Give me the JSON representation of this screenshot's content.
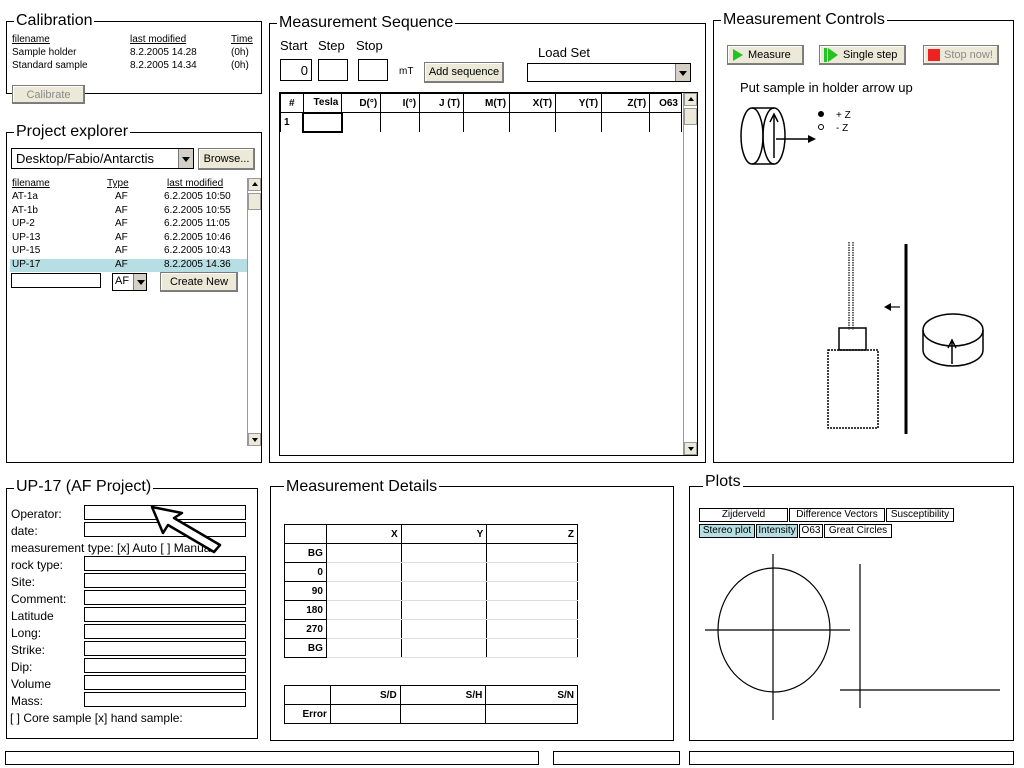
{
  "calibration": {
    "title": "Calibration",
    "headers": {
      "filename": "filename",
      "modified": "last modified",
      "time": "Time"
    },
    "rows": [
      {
        "filename": "Sample holder",
        "modified": "8.2.2005 14.28",
        "time": "(0h)"
      },
      {
        "filename": "Standard sample",
        "modified": "8.2.2005 14.34",
        "time": "(0h)"
      }
    ],
    "calibrate_label": "Calibrate"
  },
  "project_explorer": {
    "title": "Project explorer",
    "path": "Desktop/Fabio/Antarctis",
    "browse_label": "Browse...",
    "headers": {
      "filename": "filename",
      "type": "Type",
      "modified": "last modified"
    },
    "rows": [
      {
        "filename": "AT-1a",
        "type": "AF",
        "modified": "6.2.2005 10:50",
        "selected": false
      },
      {
        "filename": "AT-1b",
        "type": "AF",
        "modified": "6.2.2005 10:55",
        "selected": false
      },
      {
        "filename": "UP-2",
        "type": "AF",
        "modified": "6.2.2005 11:05",
        "selected": false
      },
      {
        "filename": "UP-13",
        "type": "AF",
        "modified": "6.2.2005 10:46",
        "selected": false
      },
      {
        "filename": "UP-15",
        "type": "AF",
        "modified": "6.2.2005 10:43",
        "selected": false
      },
      {
        "filename": "UP-17",
        "type": "AF",
        "modified": "8.2.2005 14.36",
        "selected": true
      }
    ],
    "new_name_value": "",
    "new_type_value": "AF",
    "create_label": "Create New",
    "selection_color": "#b7dfe3"
  },
  "sequence": {
    "title": "Measurement Sequence",
    "start_label": "Start",
    "step_label": "Step",
    "stop_label": "Stop",
    "start_value": "0",
    "step_value": "",
    "stop_value": "",
    "unit": "mT",
    "add_label": "Add sequence",
    "load_set_label": "Load Set",
    "load_set_value": "",
    "columns": [
      "#",
      "Tesla",
      "D(°)",
      "I(°)",
      "J (T)",
      "M(T)",
      "X(T)",
      "Y(T)",
      "Z(T)",
      "O63"
    ],
    "rows": [
      [
        "1",
        "",
        "",
        "",
        "",
        "",
        "",
        "",
        "",
        ""
      ]
    ]
  },
  "controls": {
    "title": "Measurement Controls",
    "measure_label": "Measure",
    "single_step_label": "Single step",
    "stop_label": "Stop now!",
    "instruction": "Put sample in holder arrow up",
    "plus_z": "+ Z",
    "minus_z": "- Z",
    "go_color": "#22c422",
    "stop_color": "#ee2222"
  },
  "project_form": {
    "title": "UP-17 (AF Project)",
    "operator_label": "Operator:",
    "operator_value": "",
    "date_label": "date:",
    "date_value": "",
    "mtype_label": "measurement type: [x] Auto [ ] Manual",
    "rocktype_label": "rock type:",
    "rocktype_value": "",
    "site_label": "Site:",
    "site_value": "",
    "comment_label": "Comment:",
    "comment_value": "",
    "latitude_label": "Latitude",
    "latitude_value": "",
    "long_label": "Long:",
    "long_value": "",
    "strike_label": "Strike:",
    "strike_value": "",
    "dip_label": "Dip:",
    "dip_value": "",
    "volume_label": "Volume",
    "volume_value": "",
    "mass_label": "Mass:",
    "mass_value": "",
    "sample_type_label": "[ ] Core sample [x]  hand sample:"
  },
  "details": {
    "title": "Measurement Details",
    "headers": [
      "",
      "X",
      "Y",
      "Z"
    ],
    "rows": [
      "BG",
      "0",
      "90",
      "180",
      "270",
      "BG"
    ],
    "error_headers": [
      "",
      "S/D",
      "S/H",
      "S/N"
    ],
    "error_row": "Error"
  },
  "plots": {
    "title": "Plots",
    "tabs_row1": [
      {
        "label": "Zijderveld",
        "active": false
      },
      {
        "label": "Difference Vectors",
        "active": false
      },
      {
        "label": "Susceptibility",
        "active": false
      }
    ],
    "tabs_row2": [
      {
        "label": "Stereo plot",
        "active": true
      },
      {
        "label": "Intensity",
        "active": true
      },
      {
        "label": "O63",
        "active": false
      },
      {
        "label": "Great Circles",
        "active": false
      }
    ]
  },
  "status_bar": {
    "left": "",
    "middle": "",
    "right": ""
  }
}
